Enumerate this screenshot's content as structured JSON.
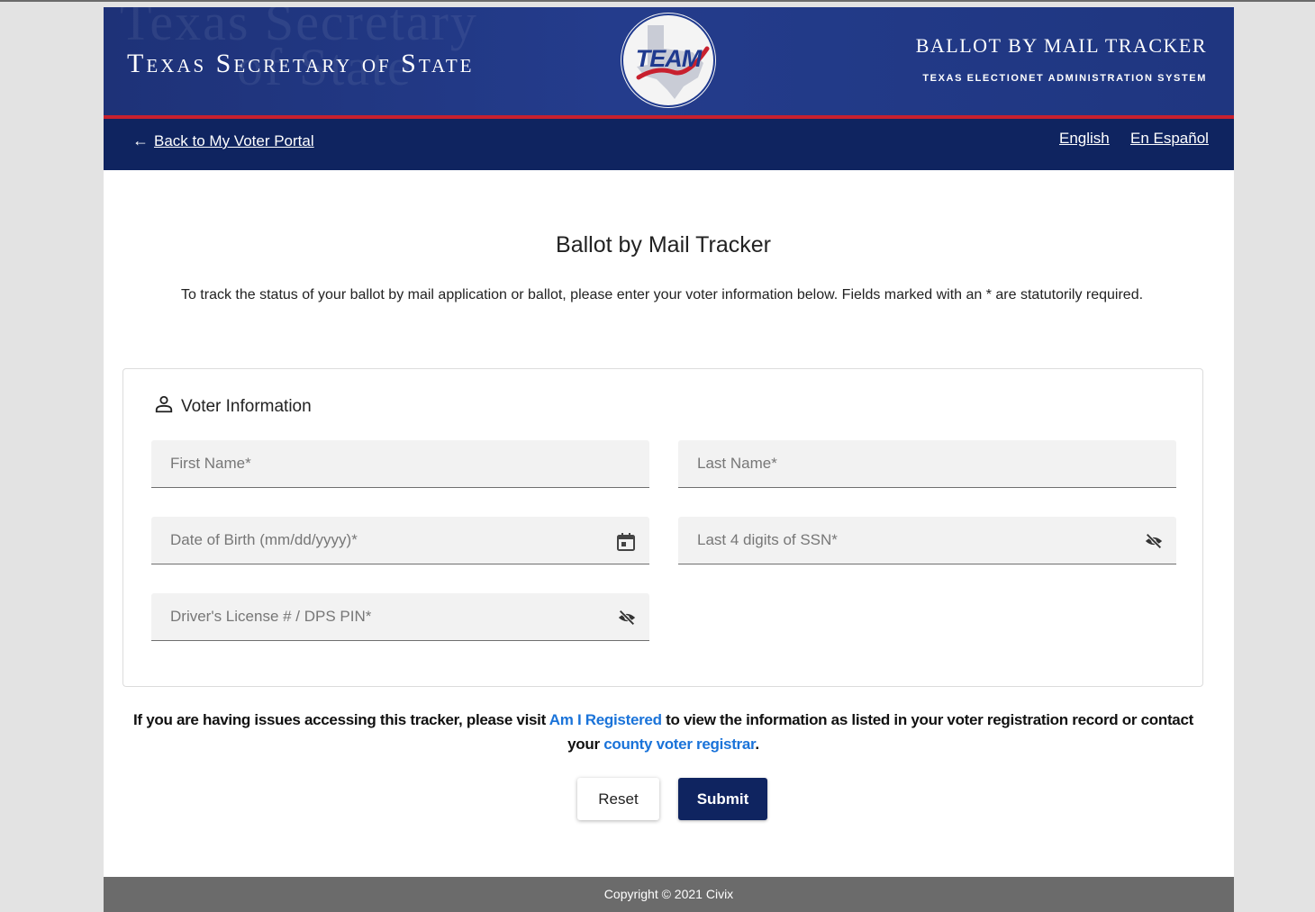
{
  "header": {
    "site_title": "Texas Secretary of State",
    "watermark_line1": "Texas Secretary",
    "watermark_line2": "of State",
    "logo_text": "TEAM",
    "tracker_title": "BALLOT BY MAIL TRACKER",
    "tracker_subtitle": "TEXAS ELECTIONET ADMINISTRATION SYSTEM",
    "colors": {
      "banner": "#1e3278",
      "navbar": "#0f2460",
      "accent_red": "#c8202e"
    }
  },
  "nav": {
    "back_arrow": "←",
    "back_link": "Back to My Voter Portal",
    "lang_english": "English",
    "lang_spanish": "En Español"
  },
  "main": {
    "title": "Ballot by Mail Tracker",
    "intro": "To track the status of your ballot by mail application or ballot, please enter your voter information below. Fields marked with an * are statutorily required."
  },
  "voter_info": {
    "heading": "Voter Information",
    "heading_icon": "person-icon",
    "fields": {
      "first_name": {
        "placeholder": "First Name*",
        "value": ""
      },
      "last_name": {
        "placeholder": "Last Name*",
        "value": ""
      },
      "dob": {
        "placeholder": "Date of Birth (mm/dd/yyyy)*",
        "value": "",
        "icon": "calendar-icon"
      },
      "ssn": {
        "placeholder": "Last 4 digits of SSN*",
        "value": "",
        "icon": "eye-off-icon"
      },
      "dl": {
        "placeholder": "Driver's License # / DPS PIN*",
        "value": "",
        "icon": "eye-off-icon"
      }
    }
  },
  "help": {
    "text_before": "If you are having issues accessing this tracker, please visit ",
    "link_registered": "Am I Registered",
    "text_middle": " to view the information as listed in your voter registration record or contact your ",
    "link_registrar": "county voter registrar",
    "text_after": ".",
    "link_color": "#1a73d9"
  },
  "buttons": {
    "reset": "Reset",
    "submit": "Submit"
  },
  "footer": {
    "copyright": "Copyright © 2021 Civix"
  }
}
